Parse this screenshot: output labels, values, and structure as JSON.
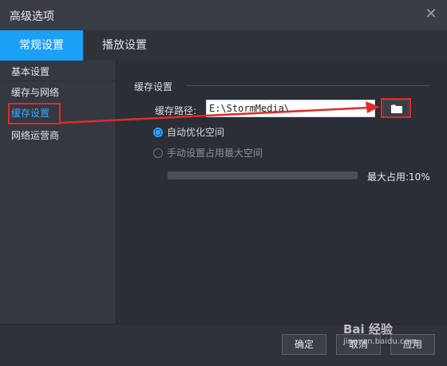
{
  "window": {
    "title": "高级选项"
  },
  "tabs": [
    {
      "label": "常规设置",
      "active": true
    },
    {
      "label": "播放设置",
      "active": false
    }
  ],
  "sidebar": {
    "items": [
      {
        "label": "基本设置"
      },
      {
        "label": "缓存与网络"
      },
      {
        "label": "缓存设置",
        "active": true
      },
      {
        "label": "网络运营商"
      }
    ]
  },
  "cache": {
    "section_title": "缓存设置",
    "path_label": "缓存路径:",
    "path_value": "E:\\StormMedia\\",
    "options": [
      {
        "label": "自动优化空间",
        "selected": true
      },
      {
        "label": "手动设置占用最大空间",
        "selected": false
      }
    ],
    "max_usage_label": "最大占用:10%"
  },
  "footer": {
    "ok_label": "确定",
    "cancel_label": "取消",
    "apply_label": "应用"
  },
  "watermark": {
    "text": "Bai 经验",
    "url": "jingyan.baidu.com"
  },
  "colors": {
    "accent": "#1aa0f5",
    "annotation": "#e02a2a"
  },
  "icons": {
    "close": "close-icon",
    "folder": "folder-icon"
  }
}
